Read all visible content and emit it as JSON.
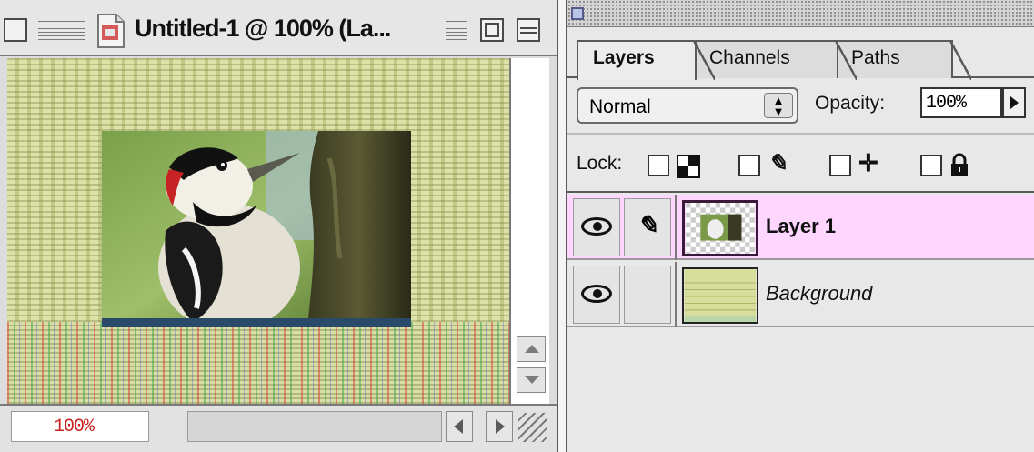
{
  "document": {
    "title": "Untitled-1 @ 100% (La...",
    "zoom_level": "100%"
  },
  "palette": {
    "tabs": [
      {
        "label": "Layers",
        "active": true
      },
      {
        "label": "Channels",
        "active": false
      },
      {
        "label": "Paths",
        "active": false
      }
    ],
    "blend_mode": "Normal",
    "opacity_label": "Opacity:",
    "opacity_value": "100%",
    "lock_label": "Lock:",
    "lock_options": [
      {
        "icon": "transparency-checker-icon"
      },
      {
        "icon": "brush-icon"
      },
      {
        "icon": "move-icon"
      },
      {
        "icon": "padlock-icon"
      }
    ],
    "layers": [
      {
        "name": "Layer 1",
        "visible": true,
        "selected": true,
        "brush_linked": true
      },
      {
        "name": "Background",
        "visible": true,
        "selected": false,
        "brush_linked": false
      }
    ]
  },
  "colors": {
    "selected_layer": "#ffd6ff",
    "canvas_texture": "#d7dd9a"
  }
}
